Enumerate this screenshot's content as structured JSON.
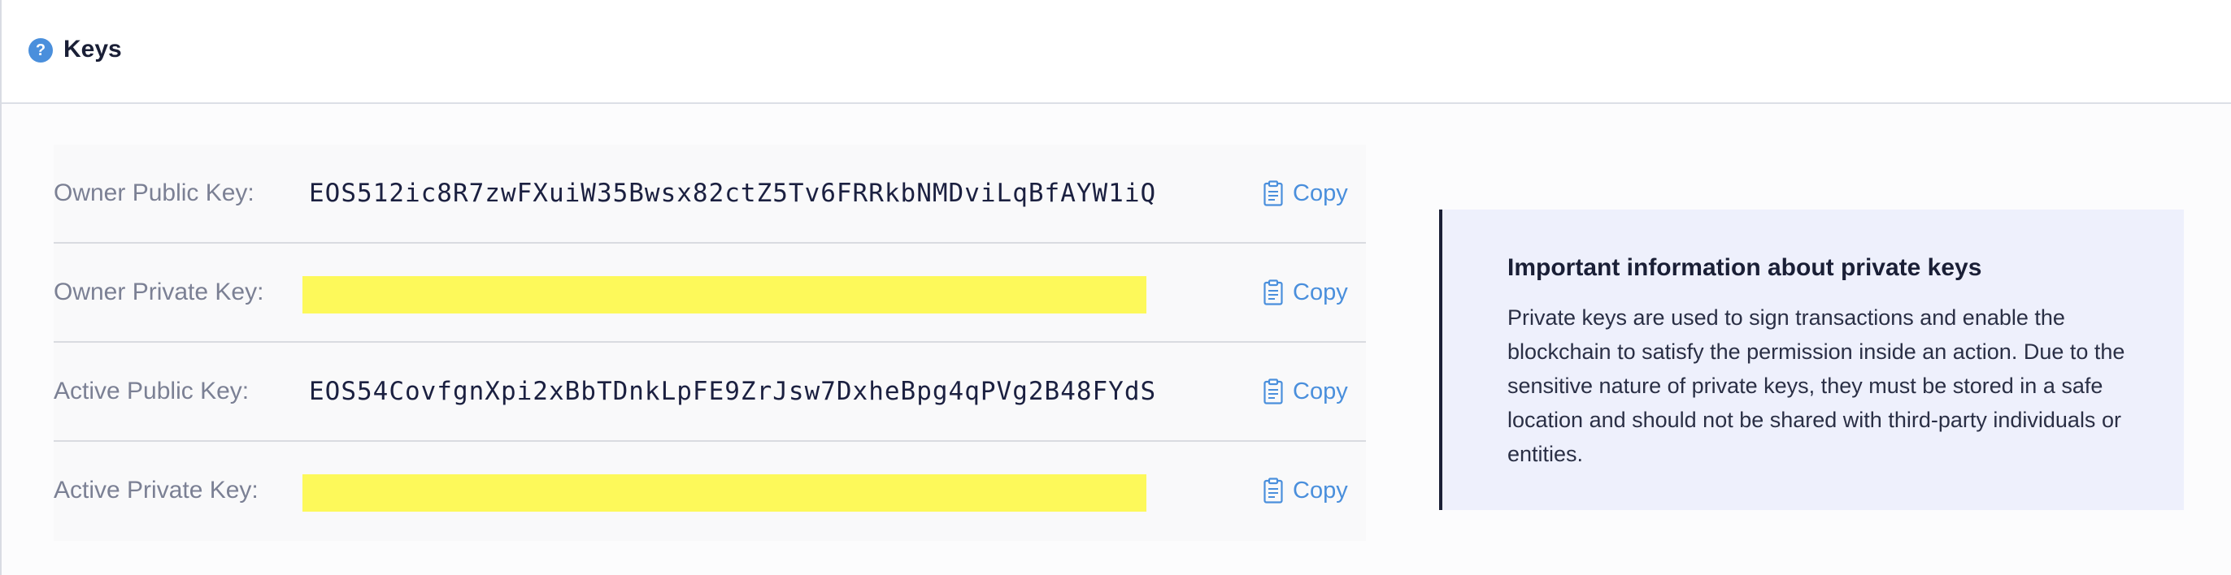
{
  "header": {
    "title": "Keys",
    "help_icon": "question-circle-icon",
    "help_glyph": "?"
  },
  "keys": [
    {
      "label": "Owner Public Key:",
      "value": "EOS512ic8R7zwFXuiW35Bwsx82ctZ5Tv6FRRkbNMDviLqBfAYW1iQ",
      "redacted": false,
      "copy_label": "Copy"
    },
    {
      "label": "Owner Private Key:",
      "value": "",
      "redacted": true,
      "copy_label": "Copy"
    },
    {
      "label": "Active Public Key:",
      "value": "EOS54CovfgnXpi2xBbTDnkLpFE9ZrJsw7DxheBpg4qPVg2B48FYdS",
      "redacted": false,
      "copy_label": "Copy"
    },
    {
      "label": "Active Private Key:",
      "value": "",
      "redacted": true,
      "copy_label": "Copy"
    }
  ],
  "info": {
    "title": "Important information about private keys",
    "body": "Private keys are used to sign transactions and enable the blockchain to satisfy the permission inside an action. Due to the sensitive nature of private keys, they must be stored in a safe location and should not be shared with third-party individuals or entities."
  },
  "colors": {
    "accent": "#4a8fdc",
    "redaction": "#fdf95a",
    "info_bg": "#eef0fc",
    "text_dark": "#1a1f36",
    "label_gray": "#7b8094"
  }
}
